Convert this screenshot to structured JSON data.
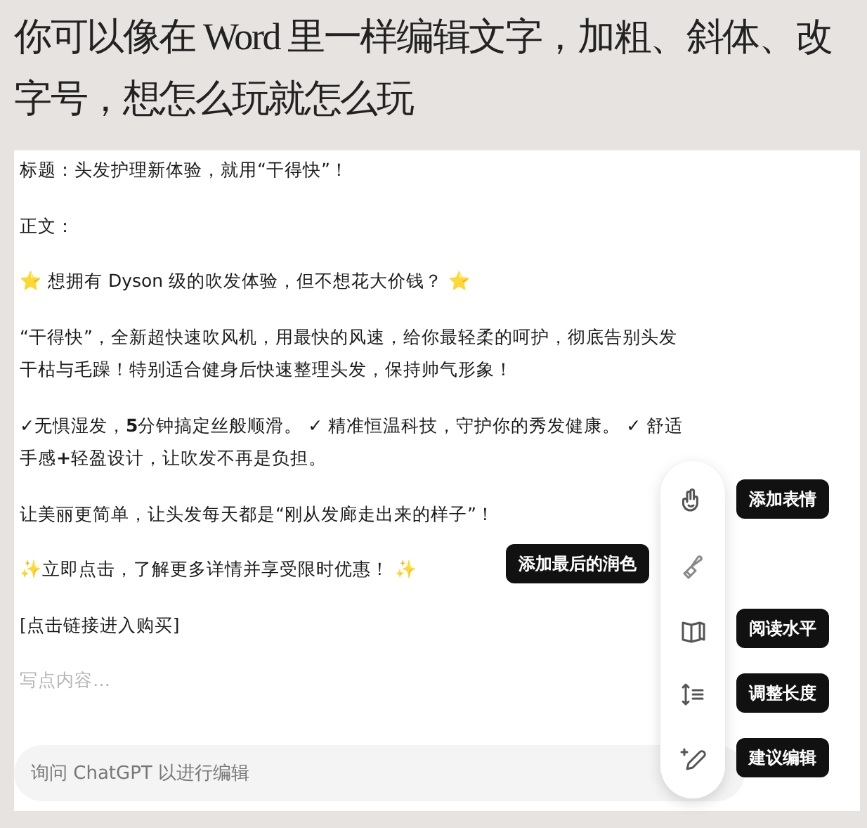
{
  "caption": "你可以像在 Word 里一样编辑文字，加粗、斜体、改字号，想怎么玩就怎么玩",
  "editor": {
    "paragraphs": [
      "标题：头发护理新体验，就用“干得快”！",
      "正文：",
      "⭐ 想拥有 Dyson 级的吹发体验，但不想花大价钱？ ⭐",
      "“干得快”，全新超快速吹风机，用最快的风速，给你最轻柔的呵护，彻底告别头发干枯与毛躁！特别适合健身后快速整理头发，保持帅气形象！",
      "✓无惧湿发，**5**分钟搞定丝般顺滑。 ✓ 精准恒温科技，守护你的秀发健康。 ✓ 舒适手感**+**轻盈设计，让吹发不再是负担。",
      "让美丽更简单，让头发每天都是“刚从发廊走出来的样子”！",
      "✨立即点击，了解更多详情并享受限时优惠！ ✨",
      "[点击链接进入购买]"
    ],
    "placeholder": "写点内容…"
  },
  "chat_input": {
    "placeholder": "询问 ChatGPT 以进行编辑"
  },
  "toolbar": {
    "tools": [
      {
        "kind": "emoji",
        "tooltip": "添加表情",
        "hovered": false
      },
      {
        "kind": "polish",
        "tooltip": "添加最后的润色",
        "hovered": true
      },
      {
        "kind": "reading",
        "tooltip": "阅读水平",
        "hovered": false
      },
      {
        "kind": "length",
        "tooltip": "调整长度",
        "hovered": false
      },
      {
        "kind": "suggest",
        "tooltip": "建议编辑",
        "hovered": false
      }
    ]
  }
}
